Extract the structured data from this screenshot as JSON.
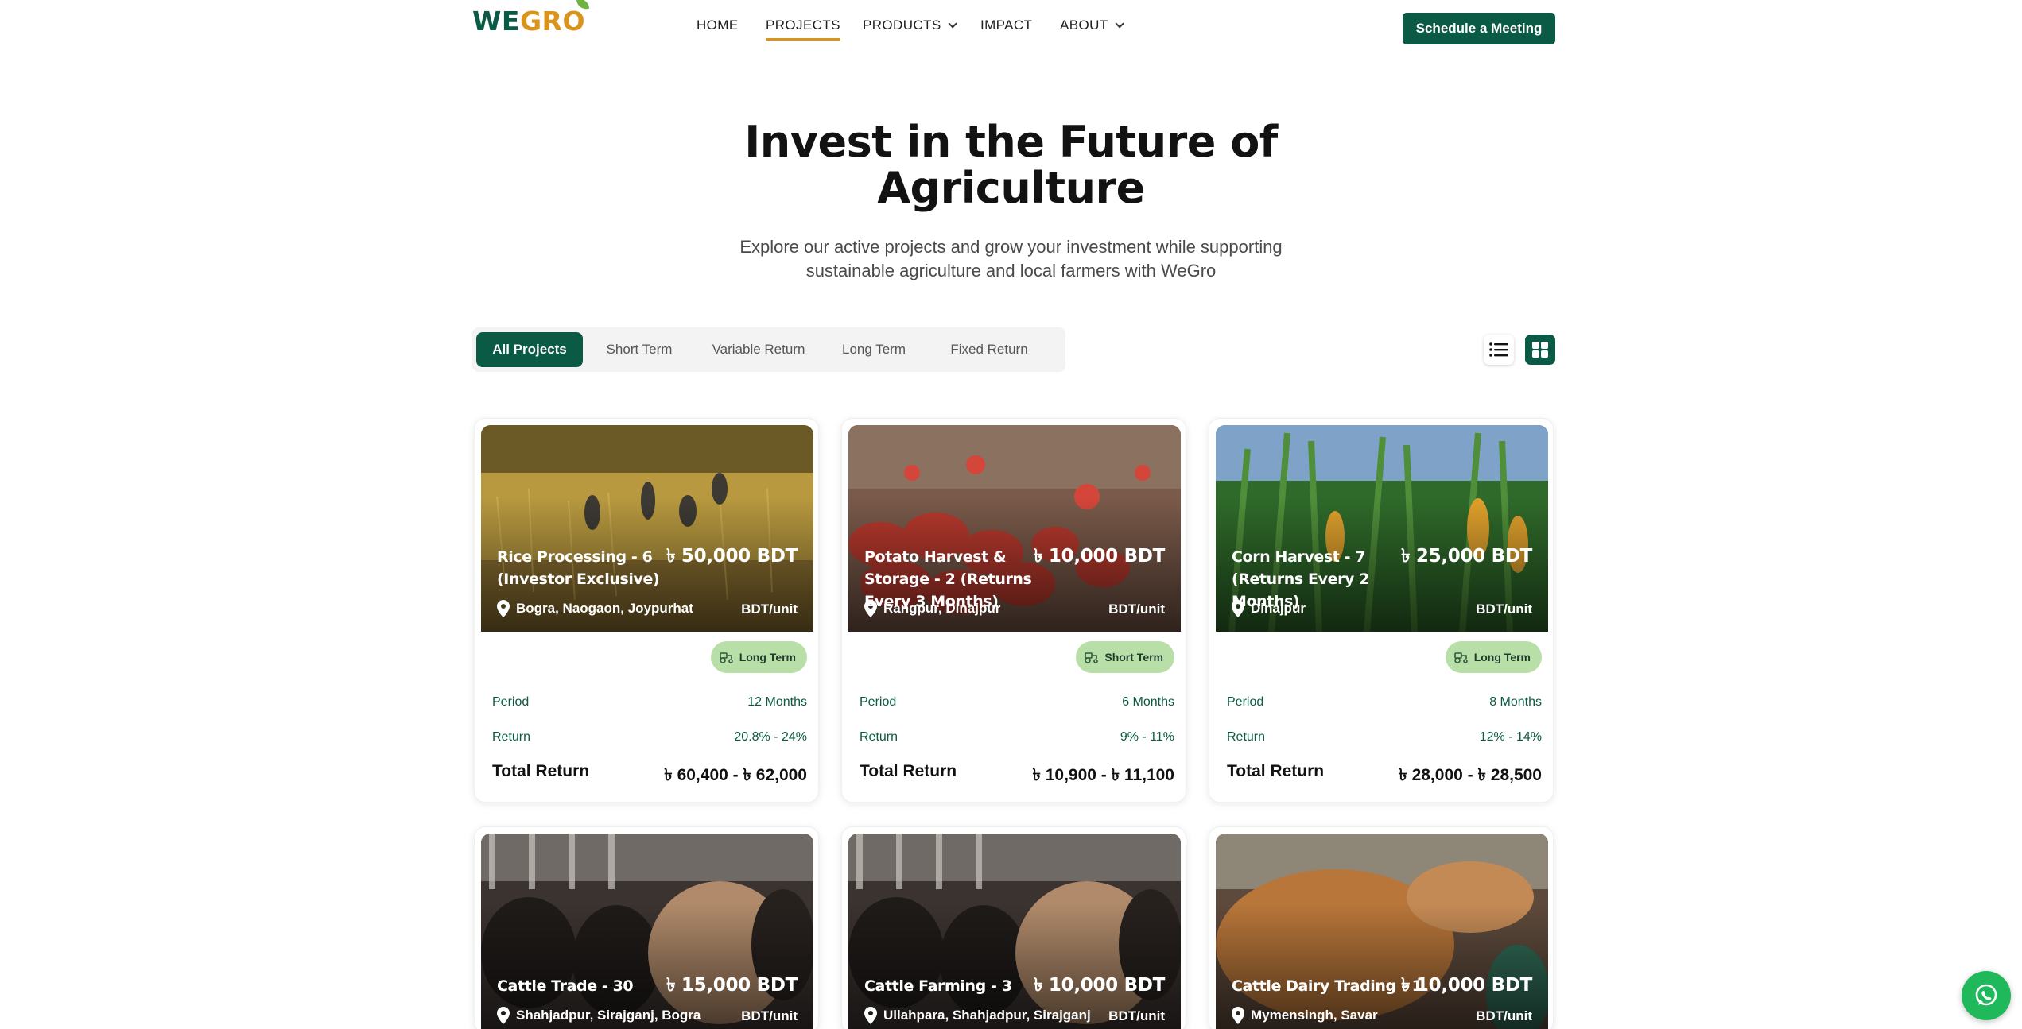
{
  "logo": {
    "part1": "WE",
    "part2": "GRO"
  },
  "nav": {
    "items": [
      {
        "label": "HOME"
      },
      {
        "label": "PROJECTS"
      },
      {
        "label": "PRODUCTS"
      },
      {
        "label": "IMPACT"
      },
      {
        "label": "ABOUT"
      }
    ],
    "cta": "Schedule a Meeting"
  },
  "hero": {
    "title_line1": "Invest in the Future of",
    "title_line2": "Agriculture",
    "subtitle_line1": "Explore our active projects and grow your investment while supporting",
    "subtitle_line2": "sustainable agriculture and local farmers with WeGro"
  },
  "filters": [
    "All Projects",
    "Short Term",
    "Variable Return",
    "Long Term",
    "Fixed Return"
  ],
  "labels": {
    "period": "Period",
    "return": "Return",
    "total_return": "Total Return"
  },
  "cards": [
    {
      "title": "Rice Processing - 6 (Investor Exclusive)",
      "price": "৳ 50,000 BDT",
      "location": "Bogra, Naogaon, Joypurhat",
      "unit": "BDT/unit",
      "tag": "Long Term",
      "period": "12 Months",
      "return": "20.8% - 24%",
      "total_return": "৳ 60,400 - ৳ 62,000",
      "image": "rice-field"
    },
    {
      "title": "Potato Harvest & Storage - 2 (Returns Every 3 Months)",
      "price": "৳ 10,000 BDT",
      "location": "Rangpur, Dinajpur",
      "unit": "BDT/unit",
      "tag": "Short Term",
      "period": "6 Months",
      "return": "9% - 11%",
      "total_return": "৳ 10,900 - ৳ 11,100",
      "image": "potato-field"
    },
    {
      "title": "Corn Harvest - 7 (Returns Every 2 Months)",
      "price": "৳ 25,000 BDT",
      "location": "Dinajpur",
      "unit": "BDT/unit",
      "tag": "Long Term",
      "period": "8 Months",
      "return": "12% - 14%",
      "total_return": "৳ 28,000 - ৳ 28,500",
      "image": "corn-field"
    },
    {
      "title": "Cattle Trade - 30",
      "price": "৳ 15,000 BDT",
      "location": "Shahjadpur, Sirajganj, Bogra",
      "unit": "BDT/unit",
      "image": "cattle"
    },
    {
      "title": "Cattle Farming - 3",
      "price": "৳ 10,000 BDT",
      "location": "Ullahpara, Shahjadpur, Sirajganj",
      "unit": "BDT/unit",
      "image": "cattle"
    },
    {
      "title": "Cattle Dairy Trading - 1",
      "price": "৳ 10,000 BDT",
      "location": "Mymensingh, Savar",
      "unit": "BDT/unit",
      "image": "cow"
    }
  ],
  "colors": {
    "brand": "#0b5a45",
    "accent": "#d9941e",
    "tag_bg": "#b9dfa8",
    "whatsapp": "#1fb85b"
  },
  "icons": [
    "list-view-icon",
    "grid-view-icon",
    "location-pin-icon",
    "tractor-icon",
    "whatsapp-icon",
    "chevron-down-icon"
  ]
}
